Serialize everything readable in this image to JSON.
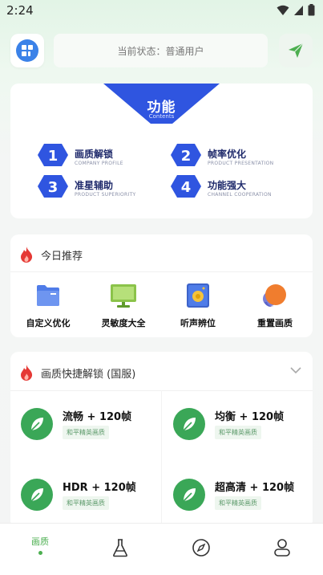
{
  "status_bar": {
    "time": "2:24"
  },
  "header": {
    "status_text": "当前状态：普通用户"
  },
  "functions": {
    "title": "功能",
    "subtitle": "Contents",
    "items": [
      {
        "num": "1",
        "title": "画质解锁",
        "sub": "COMPANY PROFILE"
      },
      {
        "num": "2",
        "title": "帧率优化",
        "sub": "PRODUCT PRESENTATION"
      },
      {
        "num": "3",
        "title": "准星辅助",
        "sub": "PRODUCT SUPERIORITY"
      },
      {
        "num": "4",
        "title": "功能强大",
        "sub": "CHANNEL COOPERATION"
      }
    ]
  },
  "today": {
    "title": "今日推荐",
    "tools": [
      {
        "label": "自定义优化",
        "icon": "folder-icon"
      },
      {
        "label": "灵敏度大全",
        "icon": "monitor-icon"
      },
      {
        "label": "听声辨位",
        "icon": "speaker-icon"
      },
      {
        "label": "重置画质",
        "icon": "reset-icon"
      }
    ]
  },
  "quick": {
    "title": "画质快捷解锁 (国服)",
    "items": [
      {
        "title": "流畅 + 120帧",
        "tag": "和平精英画质"
      },
      {
        "title": "均衡 + 120帧",
        "tag": "和平精英画质"
      },
      {
        "title": "HDR + 120帧",
        "tag": "和平精英画质"
      },
      {
        "title": "超高清 + 120帧",
        "tag": "和平精英画质"
      }
    ]
  },
  "nav": {
    "home_label": "画质"
  },
  "colors": {
    "accent": "#4caf50",
    "banner": "#2f55e0",
    "feature_text": "#1f2a6b",
    "leaf": "#3aa757"
  }
}
